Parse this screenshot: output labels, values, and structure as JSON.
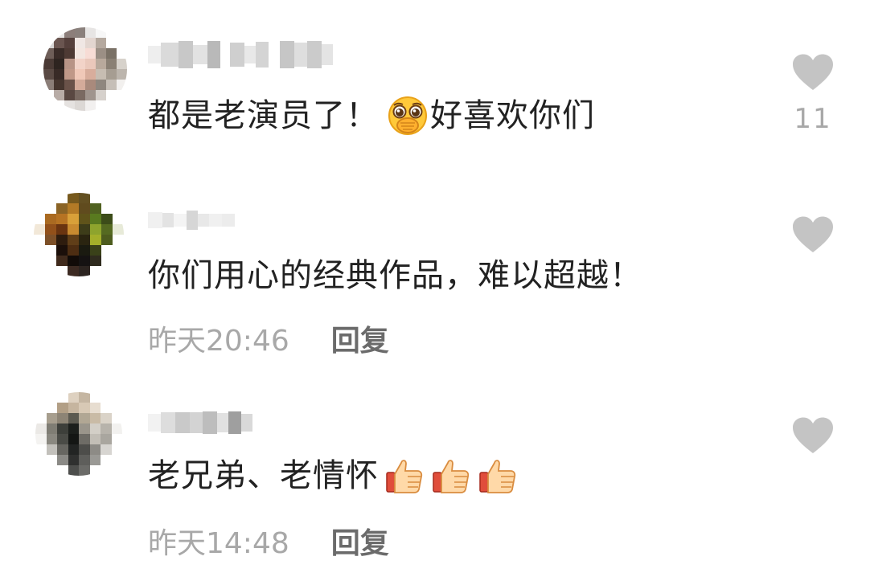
{
  "comments": [
    {
      "text_before": "都是老演员了！",
      "text_after": "好喜欢你们",
      "emoji": "shy-covering-mouth-emoji",
      "like_count": "11",
      "time": "",
      "reply_label": ""
    },
    {
      "text_before": "你们用心的经典作品，难以超越！",
      "text_after": "",
      "emoji": "",
      "like_count": "",
      "time": "昨天20:46",
      "reply_label": "回复"
    },
    {
      "text_before": "老兄弟、老情怀",
      "text_after": "",
      "emoji": "thumbs-up-emoji x3",
      "like_count": "",
      "time": "昨天14:48",
      "reply_label": "回复"
    }
  ],
  "colors": {
    "text": "#222222",
    "meta": "#a8a8a8",
    "reply": "#6b6b6b",
    "heart": "#c4c4c4"
  },
  "icons": {
    "like": "heart-icon"
  }
}
